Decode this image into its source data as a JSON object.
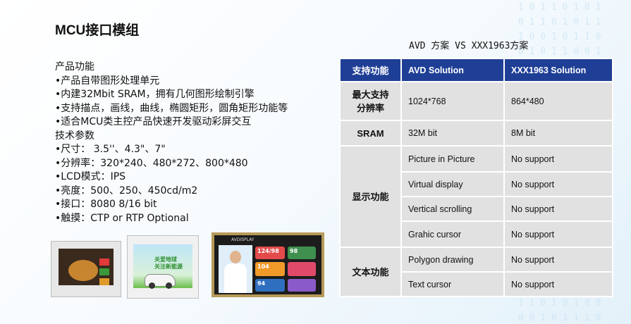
{
  "left": {
    "title": "MCU接口模组",
    "lines": [
      "产品功能",
      "•产品自带图形处理单元",
      "•内建32Mbit SRAM，拥有几何图形绘制引擎",
      "•支持描点，画线，曲线，椭圆矩形，圆角矩形功能等",
      "•适合MCU类主控产品快速开发驱动彩屏交互",
      "技术参数",
      "•尺寸： 3.5''、4.3\"、7\"",
      "•分辨率：320*240、480*272、800*480",
      "•LCD模式：IPS",
      "•亮度：500、250、450cd/m2",
      "•接口：8080 8/16 bit",
      "•触摸：CTP or RTP Optional"
    ]
  },
  "boards": {
    "board2_text": [
      "关爱地球",
      "关注新能源"
    ],
    "board3": {
      "brand": "AVDISPLAY",
      "tiles": [
        "124/98",
        "98",
        "104",
        "94"
      ]
    }
  },
  "comparison": {
    "title": "AVD 方案 VS XXX1963方案",
    "headers": [
      "支持功能",
      "AVD Solution",
      "XXX1963 Solution"
    ],
    "rows": {
      "max_res": {
        "category": [
          "最大支持",
          "分辨率"
        ],
        "avd": "1024*768",
        "xxx": "864*480"
      },
      "sram": {
        "category": "SRAM",
        "avd": "32M bit",
        "xxx": "8M bit"
      },
      "display": {
        "category": "显示功能",
        "items": [
          {
            "avd": "Picture in Picture",
            "xxx": "No support"
          },
          {
            "avd": "Virtual display",
            "xxx": "No support"
          },
          {
            "avd": "Vertical scrolling",
            "xxx": "No support"
          },
          {
            "avd": "Grahic cursor",
            "xxx": "No support"
          }
        ]
      },
      "text": {
        "category": "文本功能",
        "items": [
          {
            "avd": "Polygon drawing",
            "xxx": "No support"
          },
          {
            "avd": "Text cursor",
            "xxx": "No support"
          }
        ]
      }
    }
  },
  "colors": {
    "header_bg": "#1f3f96",
    "cell_bg": "#e1e1e1",
    "frame_gold": "#b79a5a"
  }
}
